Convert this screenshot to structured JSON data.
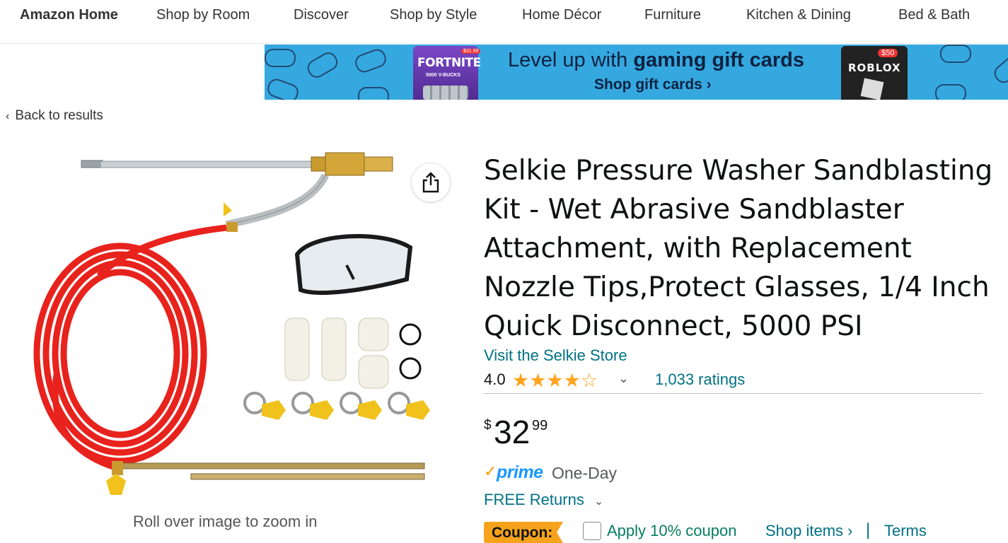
{
  "nav": {
    "items": [
      "Amazon Home",
      "Shop by Room",
      "Discover",
      "Shop by Style",
      "Home Décor",
      "Furniture",
      "Kitchen & Dining",
      "Bed & Bath"
    ]
  },
  "banner": {
    "headline_pre": "Level up with ",
    "headline_bold": "gaming gift cards",
    "cta": "Shop gift cards ›",
    "left_card": {
      "brand": "FORTNITE",
      "sub": "5000 V-BUCKS",
      "price": "$31.99"
    },
    "right_card": {
      "brand": "ROBLOX",
      "price": "$50"
    }
  },
  "back_link": {
    "chevron": "‹",
    "label": "Back to results"
  },
  "gallery": {
    "zoom_hint": "Roll over image to zoom in"
  },
  "product": {
    "title": "Selkie Pressure Washer Sandblasting Kit - Wet Abrasive Sandblaster Attachment, with Replacement Nozzle Tips,Protect Glasses, 1/4 Inch Quick Disconnect, 5000 PSI",
    "store_link": "Visit the Selkie Store",
    "rating": "4.0",
    "rating_stars": 4,
    "rating_max": 5,
    "ratings_count": "1,033 ratings",
    "price": {
      "symbol": "$",
      "whole": "32",
      "fraction": "99"
    },
    "prime": {
      "label": "prime",
      "delivery": "One-Day"
    },
    "returns": "FREE Returns",
    "coupon": {
      "badge": "Coupon:",
      "apply": "Apply 10% coupon",
      "shop": "Shop items ›",
      "separator": "|",
      "terms": "Terms"
    }
  },
  "colors": {
    "link": "#007185",
    "star": "#ffa41c",
    "prime": "#1a98ff",
    "coupon_badge": "#f7a21b",
    "banner_bg": "#35a8e0"
  }
}
